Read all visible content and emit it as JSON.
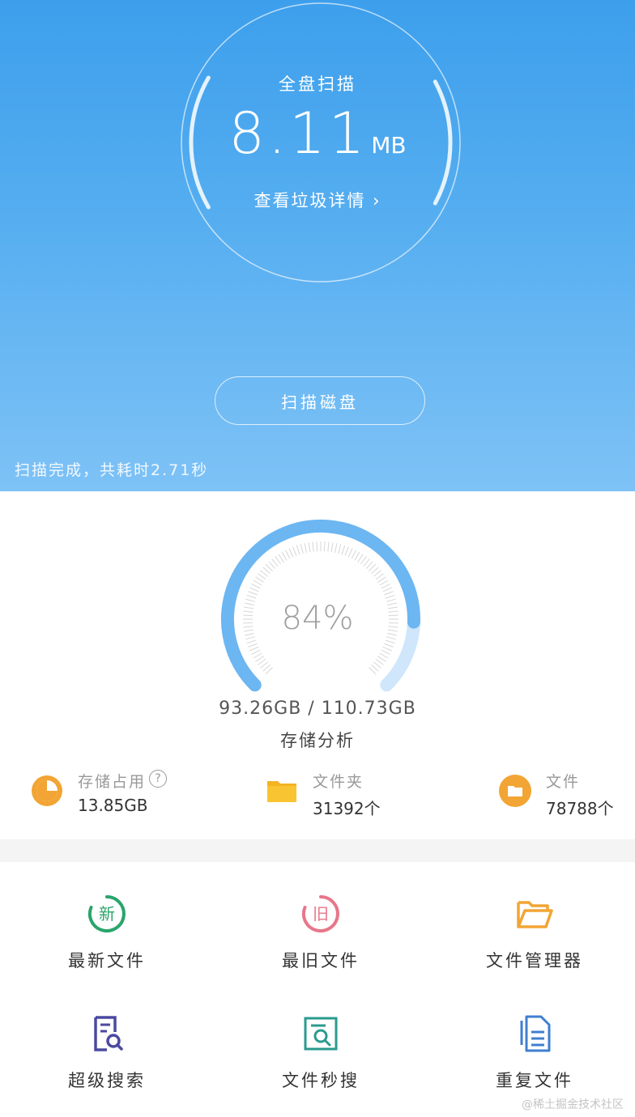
{
  "header": {
    "scan_title": "全盘扫描",
    "junk_size": "8.11",
    "junk_unit": "MB",
    "detail_link": "查看垃圾详情",
    "detail_chevron": "›",
    "scan_button": "扫描磁盘",
    "scan_status": "扫描完成，共耗时2.71秒"
  },
  "storage": {
    "used_fraction": 0.84,
    "percent_label": "84%",
    "capacity": "93.26GB / 110.73GB",
    "label": "存储分析"
  },
  "stats": [
    {
      "label": "存储占用",
      "value": "13.85GB",
      "icon": "pie-chart-icon",
      "help": "?"
    },
    {
      "label": "文件夹",
      "value": "31392个",
      "icon": "folder-icon"
    },
    {
      "label": "文件",
      "value": "78788个",
      "icon": "file-folder-icon"
    }
  ],
  "tools": [
    {
      "label": "最新文件",
      "icon": "new-icon",
      "glyph": "新"
    },
    {
      "label": "最旧文件",
      "icon": "old-icon",
      "glyph": "旧"
    },
    {
      "label": "文件管理器",
      "icon": "folder-open-icon"
    },
    {
      "label": "超级搜索",
      "icon": "search-document-icon"
    },
    {
      "label": "文件秒搜",
      "icon": "quick-search-icon"
    },
    {
      "label": "重复文件",
      "icon": "duplicate-file-icon"
    }
  ],
  "watermark": "@稀土掘金技术社区",
  "colors": {
    "header_blue": "#3d9fec",
    "gauge_blue": "#6cb6f2",
    "gauge_light": "#cfe6fb",
    "orange": "#f2a534",
    "green": "#2aa56b",
    "pink": "#e8768a",
    "purple": "#4a4aa0",
    "teal": "#2a9a8e",
    "navy_blue": "#3f7fd0"
  }
}
